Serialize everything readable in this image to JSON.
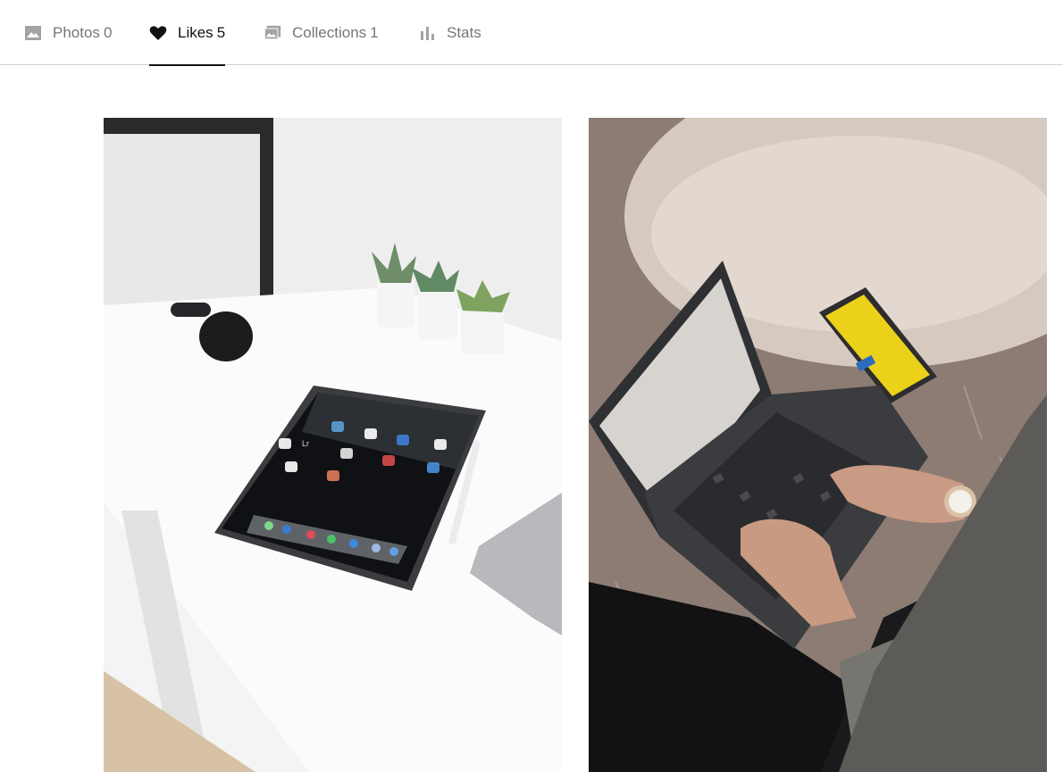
{
  "tabs": [
    {
      "label": "Photos",
      "count": "0",
      "icon": "image-icon"
    },
    {
      "label": "Likes",
      "count": "5",
      "icon": "heart-icon",
      "active": true
    },
    {
      "label": "Collections",
      "count": "1",
      "icon": "collections-icon"
    },
    {
      "label": "Stats",
      "count": "",
      "icon": "stats-icon"
    }
  ],
  "photos": [
    {
      "name": "liked-photo-ipad-desk",
      "screen_text": "Lr"
    },
    {
      "name": "liked-photo-laptop-rug"
    }
  ],
  "colors": {
    "active_tab": "#111111",
    "inactive_tab": "#767676",
    "divider": "#d1d1d1"
  }
}
